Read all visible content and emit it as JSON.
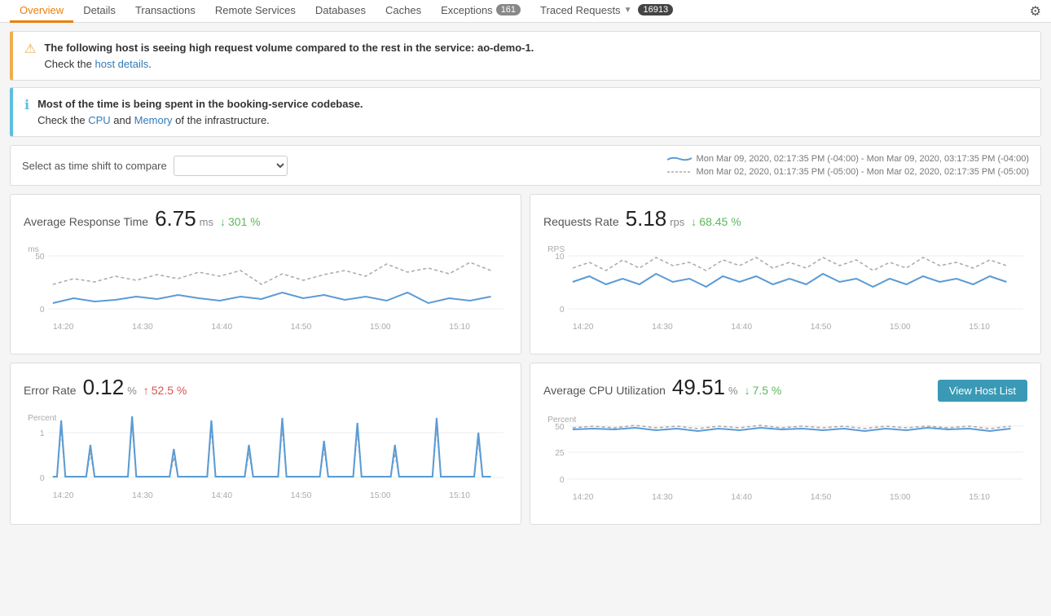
{
  "nav": {
    "items": [
      {
        "label": "Overview",
        "active": true
      },
      {
        "label": "Details",
        "active": false
      },
      {
        "label": "Transactions",
        "active": false
      },
      {
        "label": "Remote Services",
        "active": false
      },
      {
        "label": "Databases",
        "active": false
      },
      {
        "label": "Caches",
        "active": false
      },
      {
        "label": "Exceptions",
        "active": false,
        "badge": "161"
      },
      {
        "label": "Traced Requests",
        "active": false,
        "badge": "16913"
      }
    ],
    "settings_icon": "⚙"
  },
  "alerts": [
    {
      "type": "warning",
      "icon": "⚠",
      "bold_text": "The following host is seeing high request volume compared to the rest in the service: ao-demo-1.",
      "normal_text": "Check the ",
      "link_text": "host details",
      "after_link": "."
    },
    {
      "type": "info",
      "icon": "ℹ",
      "bold_text": "Most of the time is being spent in the booking-service codebase.",
      "line2_pre": "Check the ",
      "link1_text": "CPU",
      "middle_text": " and ",
      "link2_text": "Memory",
      "line2_post": " of the infrastructure."
    }
  ],
  "time_shift": {
    "label": "Select as time shift to compare",
    "placeholder": "",
    "legend": [
      {
        "type": "solid",
        "text": "Mon Mar 09, 2020, 02:17:35 PM (-04:00) - Mon Mar 09, 2020, 03:17:35 PM (-04:00)"
      },
      {
        "type": "dashed",
        "text": "Mon Mar 02, 2020, 01:17:35 PM (-05:00) - Mon Mar 02, 2020, 02:17:35 PM (-05:00)"
      }
    ]
  },
  "metrics": [
    {
      "id": "avg-response-time",
      "title": "Average Response Time",
      "value": "6.75",
      "unit": "ms",
      "change": "301 %",
      "change_dir": "down",
      "y_label": "ms",
      "y_ticks": [
        "50",
        "0"
      ],
      "x_ticks": [
        "14:20",
        "14:30",
        "14:40",
        "14:50",
        "15:00",
        "15:10"
      ]
    },
    {
      "id": "requests-rate",
      "title": "Requests Rate",
      "value": "5.18",
      "unit": "rps",
      "change": "68.45 %",
      "change_dir": "down",
      "y_label": "RPS",
      "y_ticks": [
        "10",
        "0"
      ],
      "x_ticks": [
        "14:20",
        "14:30",
        "14:40",
        "14:50",
        "15:00",
        "15:10"
      ]
    },
    {
      "id": "error-rate",
      "title": "Error Rate",
      "value": "0.12",
      "unit": "%",
      "change": "52.5 %",
      "change_dir": "up",
      "y_label": "Percent",
      "y_ticks": [
        "1",
        "0"
      ],
      "x_ticks": [
        "14:20",
        "14:30",
        "14:40",
        "14:50",
        "15:00",
        "15:10"
      ]
    },
    {
      "id": "avg-cpu",
      "title": "Average CPU Utilization",
      "value": "49.51",
      "unit": "%",
      "change": "7.5 %",
      "change_dir": "down",
      "has_button": true,
      "button_label": "View Host List",
      "y_label": "Percent",
      "y_ticks": [
        "50",
        "25",
        "0"
      ],
      "x_ticks": [
        "14:20",
        "14:30",
        "14:40",
        "14:50",
        "15:00",
        "15:10"
      ]
    }
  ]
}
